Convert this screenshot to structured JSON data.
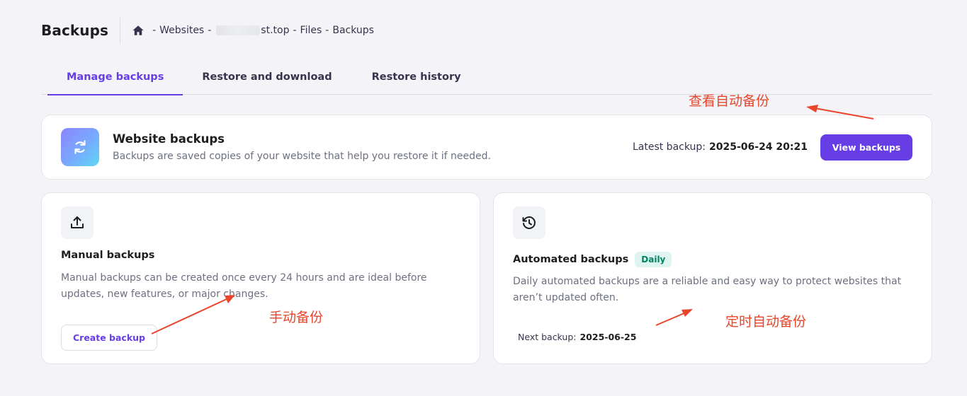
{
  "header": {
    "title": "Backups",
    "breadcrumb": {
      "home_icon": "home-icon",
      "separator": "-",
      "websites": "Websites",
      "domain_visible": "st.top",
      "files": "Files",
      "backups": "Backups"
    }
  },
  "tabs": [
    {
      "label": "Manage backups",
      "active": true
    },
    {
      "label": "Restore and download",
      "active": false
    },
    {
      "label": "Restore history",
      "active": false
    }
  ],
  "website_backups": {
    "icon": "sync-icon",
    "title": "Website backups",
    "description": "Backups are saved copies of your website that help you restore it if needed.",
    "latest_label": "Latest backup:",
    "latest_value": "2025-06-24 20:21",
    "button": "View backups"
  },
  "manual_backups": {
    "icon": "upload-icon",
    "title": "Manual backups",
    "description": "Manual backups can be created once every 24 hours and are ideal before updates, new features, or major changes.",
    "button": "Create backup"
  },
  "automated_backups": {
    "icon": "history-icon",
    "title": "Automated backups",
    "badge": "Daily",
    "description": "Daily automated backups are a reliable and easy way to protect websites that aren’t updated often.",
    "next_label": "Next backup:",
    "next_value": "2025-06-25"
  },
  "annotations": {
    "view_auto": "查看自动备份",
    "manual": "手动备份",
    "scheduled": "定时自动备份"
  },
  "colors": {
    "accent": "#673de6",
    "annotation": "#e8452a",
    "badge_bg": "#def4f0",
    "badge_text": "#008361"
  }
}
